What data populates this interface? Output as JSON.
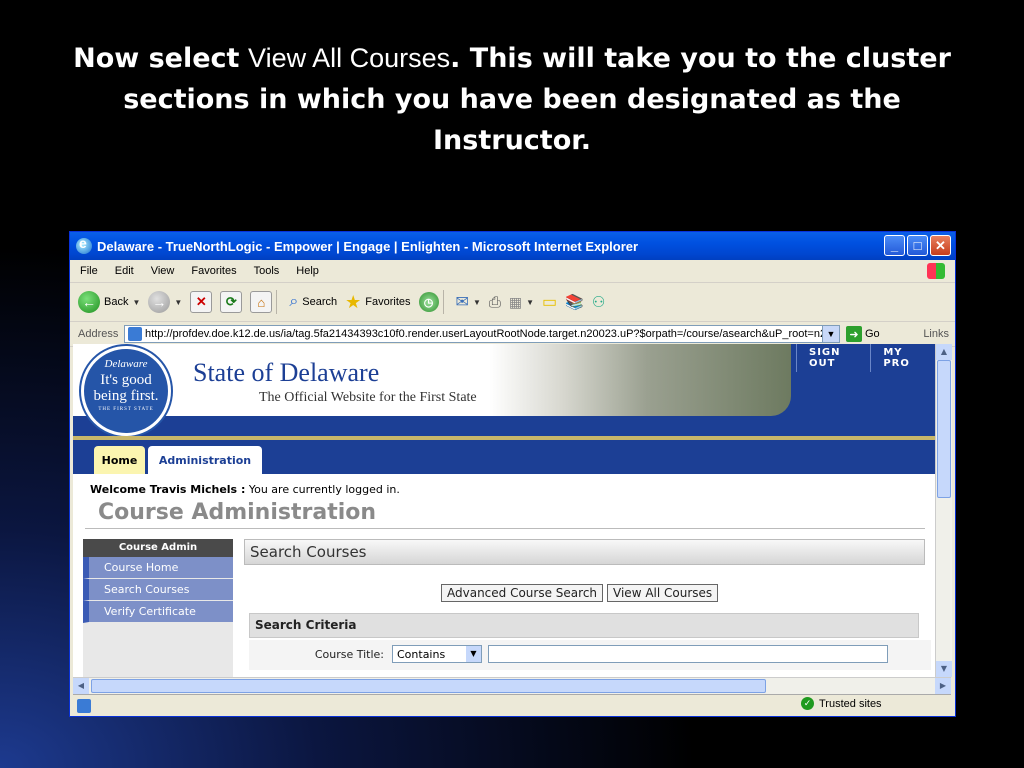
{
  "slide": {
    "title_part1": "Now select",
    "title_part2": "View All Courses",
    "title_part3": ".  This will take you to the cluster sections in which you have been designated as the Instructor."
  },
  "window": {
    "title": "Delaware - TrueNorthLogic - Empower | Engage | Enlighten - Microsoft Internet Explorer"
  },
  "menu": [
    "File",
    "Edit",
    "View",
    "Favorites",
    "Tools",
    "Help"
  ],
  "toolbar": {
    "back": "Back",
    "search": "Search",
    "favorites": "Favorites"
  },
  "address": {
    "label": "Address",
    "url": "http://profdev.doe.k12.de.us/ia/tag.5fa21434393c10f0.render.userLayoutRootNode.target.n20023.uP?$orpath=/course/asearch&uP_root=n2",
    "go": "Go",
    "links": "Links"
  },
  "site": {
    "seal_line1": "Delaware",
    "seal_line2": "It's good being first.",
    "seal_line3": "THE FIRST STATE",
    "title": "State of Delaware",
    "subtitle": "The Official Website for the First State",
    "nav": [
      "SIGN OUT",
      "MY PRO"
    ],
    "tabs": [
      "Home",
      "Administration"
    ],
    "welcome_name": "Welcome Travis Michels :",
    "welcome_msg": "You are currently logged in.",
    "heading": "Course Administration"
  },
  "leftnav": {
    "header": "Course Admin",
    "items": [
      "Course Home",
      "Search Courses",
      "Verify Certificate"
    ]
  },
  "search": {
    "heading": "Search Courses",
    "btn_advanced": "Advanced Course Search",
    "btn_view_all": "View All Courses",
    "criteria_heading": "Search Criteria",
    "course_title_label": "Course Title:",
    "course_title_op": "Contains",
    "course_title_value": ""
  },
  "status": {
    "zone": "Trusted sites"
  }
}
